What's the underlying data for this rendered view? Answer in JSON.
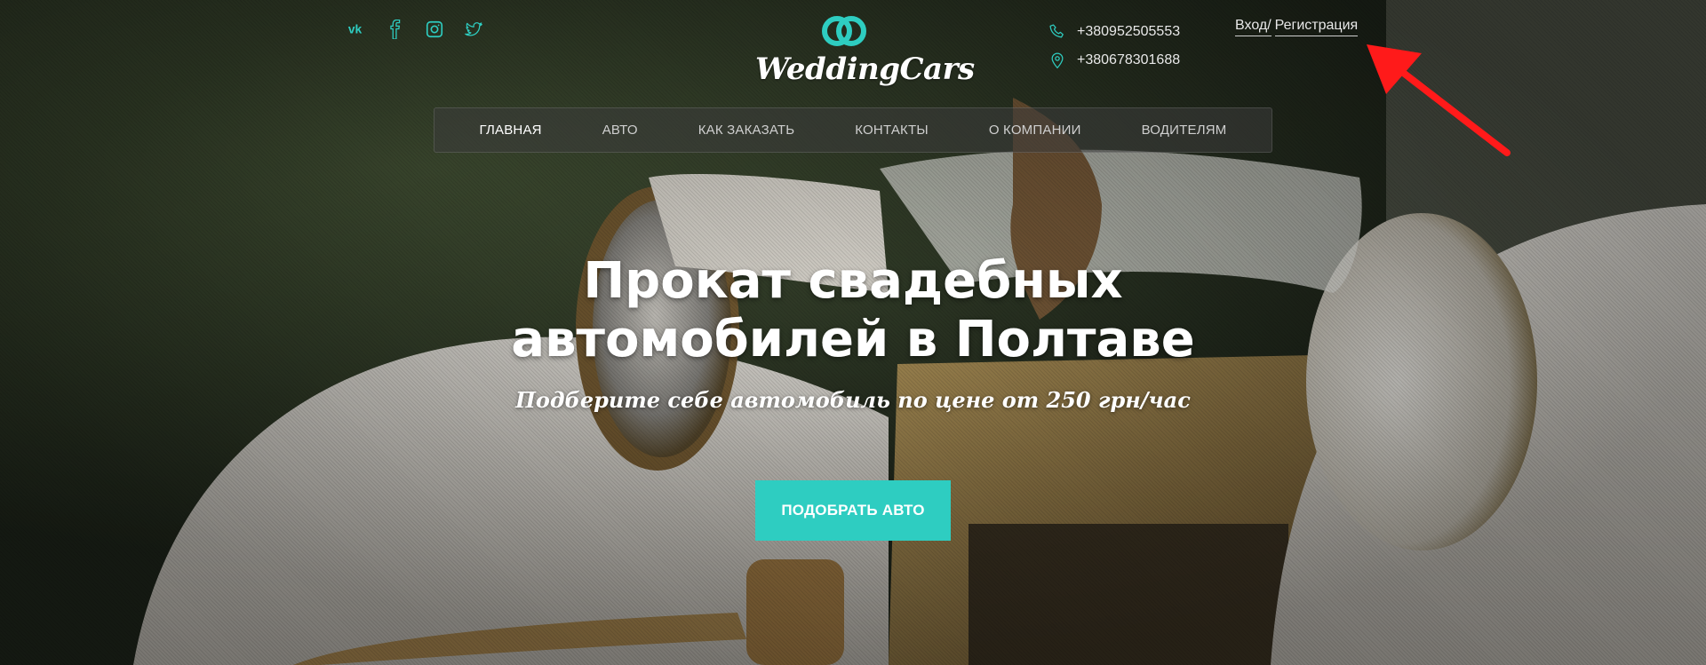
{
  "brand": {
    "name": "WeddingCars",
    "accent": "#2ecdc1"
  },
  "socials": [
    {
      "icon": "vk-icon"
    },
    {
      "icon": "facebook-icon"
    },
    {
      "icon": "instagram-icon"
    },
    {
      "icon": "twitter-icon"
    }
  ],
  "contacts": {
    "phone": "+380952505553",
    "phone_alt": "+380678301688"
  },
  "auth": {
    "login": "Вход/",
    "register": "Регистрация"
  },
  "nav": {
    "items": [
      {
        "label": "Главная",
        "active": true
      },
      {
        "label": "Авто"
      },
      {
        "label": "Как заказать"
      },
      {
        "label": "Контакты"
      },
      {
        "label": "О компании"
      },
      {
        "label": "Водителям"
      }
    ]
  },
  "hero": {
    "title_line1": "Прокат свадебных",
    "title_line2": "автомобилей в Полтаве",
    "subtitle": "Подберите себе автомобиль по цене от 250 грн/час",
    "cta": "Подобрать авто"
  },
  "annotation": {
    "color": "#ff1a1a"
  }
}
